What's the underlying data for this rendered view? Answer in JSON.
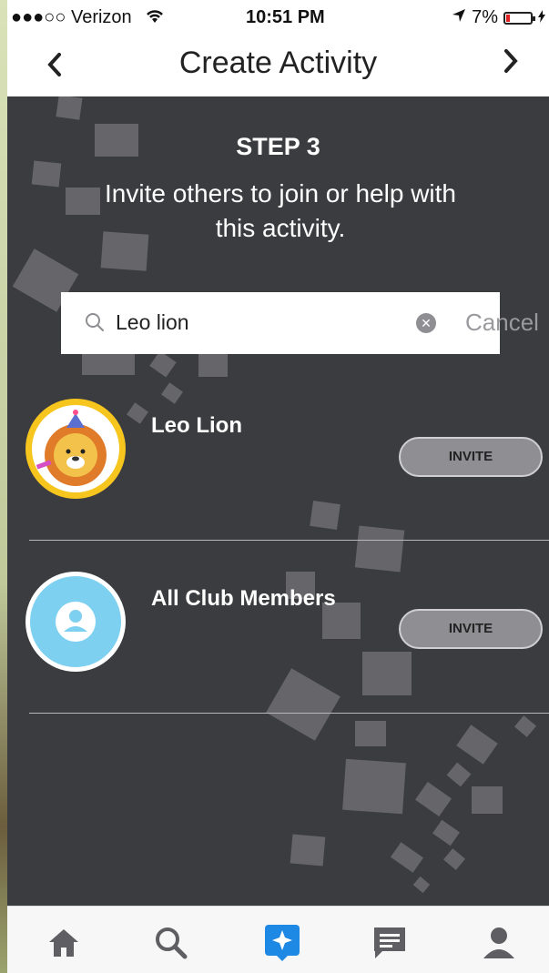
{
  "status_bar": {
    "carrier": "●●●○○ Verizon",
    "time": "10:51 PM",
    "battery": "7%"
  },
  "nav": {
    "title": "Create Activity",
    "back_icon": "chevron-left-icon",
    "forward_icon": "chevron-right-icon"
  },
  "step": {
    "title": "STEP 3",
    "description": "Invite others to join or help with this activity."
  },
  "search": {
    "query": "Leo lion",
    "cancel_label": "Cancel"
  },
  "results": [
    {
      "name": "Leo Lion",
      "invite_label": "INVITE"
    },
    {
      "name": "All Club Members",
      "invite_label": "INVITE"
    }
  ],
  "tabs": [
    {
      "icon": "home-icon"
    },
    {
      "icon": "search-icon"
    },
    {
      "icon": "create-activity-icon",
      "active": true
    },
    {
      "icon": "messages-icon"
    },
    {
      "icon": "profile-icon"
    }
  ],
  "colors": {
    "background": "#3b3c40",
    "accent": "#1e88e5",
    "tab_inactive": "#5f5f63"
  }
}
